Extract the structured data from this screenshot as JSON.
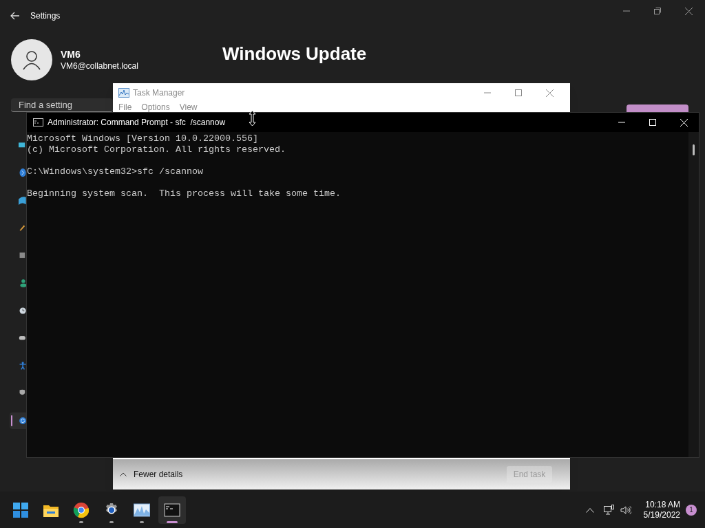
{
  "settings": {
    "title": "Settings",
    "user": {
      "name": "VM6",
      "email": "VM6@collabnet.local"
    },
    "heading": "Windows Update",
    "search": {
      "placeholder": "Find a setting"
    },
    "sidebar": [
      {
        "kind": "display",
        "selected": false
      },
      {
        "kind": "bluetooth",
        "selected": false
      },
      {
        "kind": "network",
        "selected": false
      },
      {
        "kind": "brush",
        "selected": false
      },
      {
        "kind": "apps",
        "selected": false
      },
      {
        "kind": "accounts",
        "selected": false
      },
      {
        "kind": "time",
        "selected": false
      },
      {
        "kind": "gaming",
        "selected": false
      },
      {
        "kind": "accessibility",
        "selected": false
      },
      {
        "kind": "privacy",
        "selected": false
      },
      {
        "kind": "update",
        "selected": true
      }
    ]
  },
  "task_manager": {
    "title": "Task Manager",
    "menu": [
      "File",
      "Options",
      "View"
    ],
    "details_toggle": "Fewer details",
    "end_task": {
      "label": "End task",
      "disabled": true
    }
  },
  "command_prompt": {
    "title": "Administrator: Command Prompt - sfc  /scannow",
    "paragraphs": [
      [
        "Microsoft Windows [Version 10.0.22000.556]",
        "(c) Microsoft Corporation. All rights reserved."
      ],
      [
        "C:\\Windows\\system32>sfc /scannow"
      ],
      [
        "Beginning system scan.  This process will take some time."
      ]
    ]
  },
  "taskbar": {
    "apps": [
      {
        "kind": "start",
        "running": false,
        "active": false
      },
      {
        "kind": "explorer",
        "running": false,
        "active": false
      },
      {
        "kind": "chrome",
        "running": true,
        "active": false
      },
      {
        "kind": "settings",
        "running": true,
        "active": false
      },
      {
        "kind": "taskmanager",
        "running": true,
        "active": false
      },
      {
        "kind": "terminal",
        "running": true,
        "active": true
      }
    ],
    "time": "10:18 AM",
    "date": "5/19/2022",
    "notifications": "1"
  }
}
